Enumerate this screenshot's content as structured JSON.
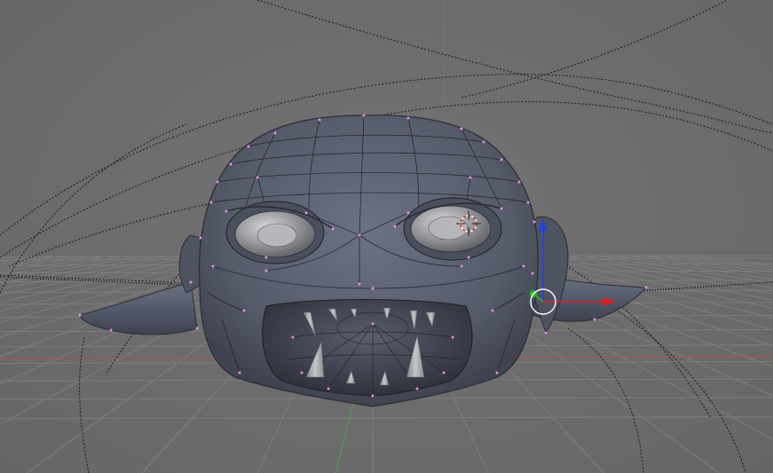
{
  "viewport": {
    "background_color": "#6b6b6b",
    "grid_color": "#7d7d7d",
    "x_axis_color": "#b45050",
    "y_axis_color": "#5a9a5a",
    "mesh_color": "#5f6575",
    "mesh_dark_color": "#3d4150",
    "wire_color": "#1e1f26",
    "selected_vertex_color": "#e28fe2",
    "teeth_color": "#a9abae",
    "eye_color": "#9a9ca0",
    "curve_color": "#1a1a1a"
  },
  "gizmo": {
    "x_color": "#e02020",
    "y_color": "#20c020",
    "z_color": "#2040e0",
    "ring_color": "#ffffff"
  },
  "cursor_3d": {
    "icon": "3d-cursor-icon"
  }
}
